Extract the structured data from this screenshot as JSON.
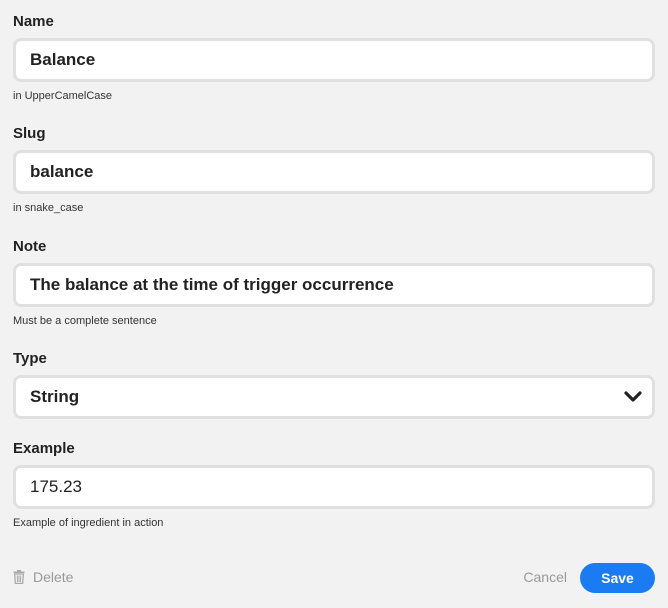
{
  "fields": {
    "name": {
      "label": "Name",
      "value": "Balance",
      "hint": "in UpperCamelCase"
    },
    "slug": {
      "label": "Slug",
      "value": "balance",
      "hint": "in snake_case"
    },
    "note": {
      "label": "Note",
      "value": "The balance at the time of trigger occurrence",
      "hint": "Must be a complete sentence"
    },
    "type": {
      "label": "Type",
      "selected": "String",
      "icon": "chevron-down-icon"
    },
    "example": {
      "label": "Example",
      "value": "175.23",
      "hint": "Example of ingredient in action"
    }
  },
  "footer": {
    "delete_label": "Delete",
    "delete_icon": "trash-icon",
    "cancel_label": "Cancel",
    "save_label": "Save"
  },
  "colors": {
    "accent": "#1a7bf2",
    "background": "#f2f2f2",
    "muted_text": "#999999"
  }
}
